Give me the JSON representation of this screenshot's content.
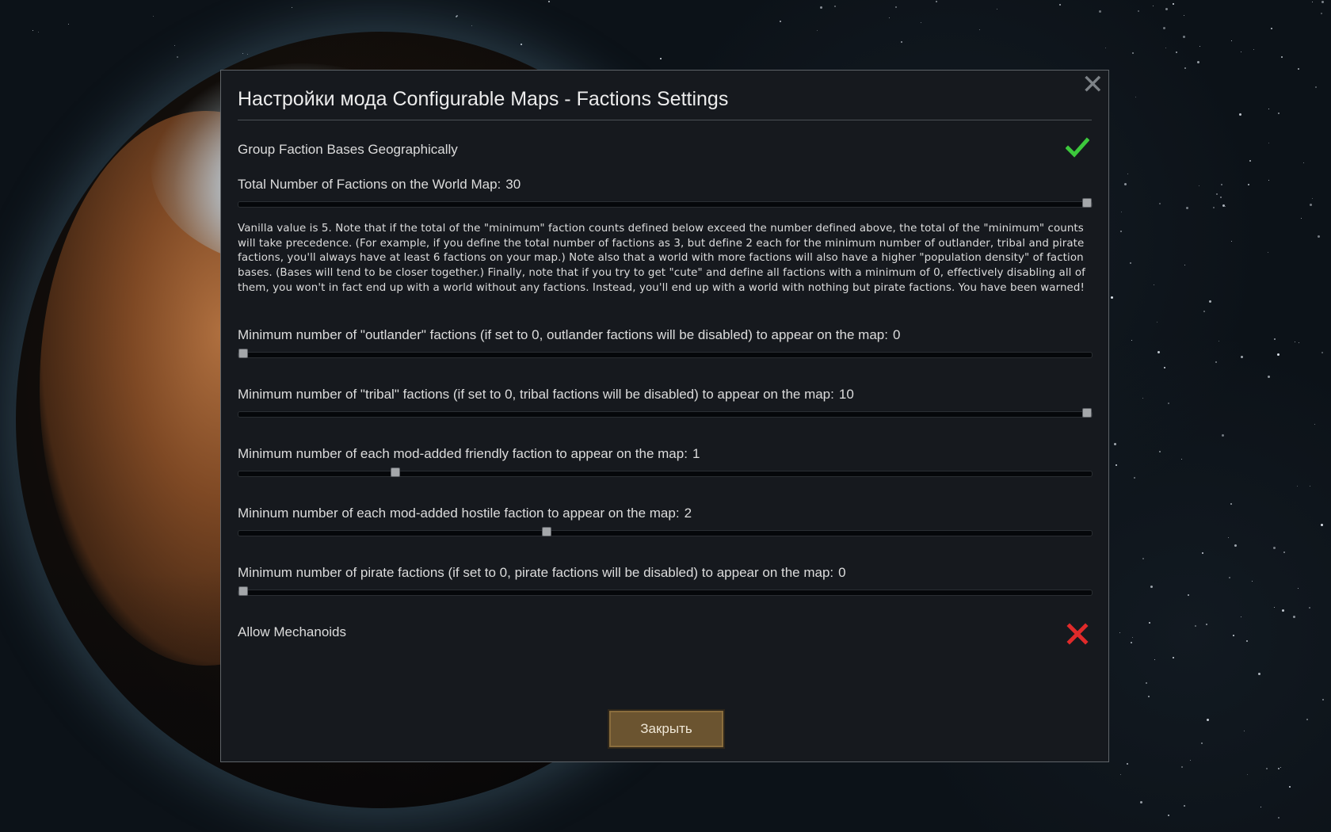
{
  "dialog": {
    "title": "Настройки мода Configurable Maps - Factions Settings",
    "close_icon": "close-icon",
    "group_bases": {
      "label": "Group Faction Bases Geographically",
      "checked": true,
      "icon": "checkmark-icon",
      "color": "#3cc83c"
    },
    "total_factions": {
      "label": "Total Number of Factions on the World Map:",
      "value": "30",
      "fraction": 1.0
    },
    "description": "Vanilla value is 5. Note that if the total of the \"minimum\" faction counts defined below exceed the number defined above, the total of the \"minimum\" counts will take precedence. (For example, if you define the total number of factions as 3, but define 2 each for the minimum number of outlander, tribal and pirate factions, you'll always have at least 6 factions on your map.) Note also that a world with more factions will also have a higher \"population density\" of faction bases. (Bases will tend to be closer together.) Finally, note that if you try to get \"cute\" and define all factions with a minimum of 0, effectively disabling all of them, you won't in fact end up with a world without any factions. Instead, you'll end up with a world with nothing but pirate factions. You have been warned!",
    "sliders": [
      {
        "label": "Minimum number of \"outlander\" factions (if set to 0, outlander factions will be disabled) to appear on the map:",
        "value": "0",
        "fraction": 0.0
      },
      {
        "label": "Minimum number of \"tribal\" factions (if set to 0, tribal factions will be disabled) to appear on the map:",
        "value": "10",
        "fraction": 1.0
      },
      {
        "label": "Minimum number of each mod-added friendly faction to appear on the map:",
        "value": "1",
        "fraction": 0.18
      },
      {
        "label": "Mininum number of each mod-added hostile faction to appear on the map:",
        "value": "2",
        "fraction": 0.36
      },
      {
        "label": "Minimum number of pirate factions (if set to 0, pirate factions will be disabled) to appear on the map:",
        "value": "0",
        "fraction": 0.0
      }
    ],
    "allow_mechanoids": {
      "label": "Allow Mechanoids",
      "checked": false,
      "icon": "cross-icon",
      "color": "#e02a2a"
    },
    "close_button": "Закрыть"
  }
}
